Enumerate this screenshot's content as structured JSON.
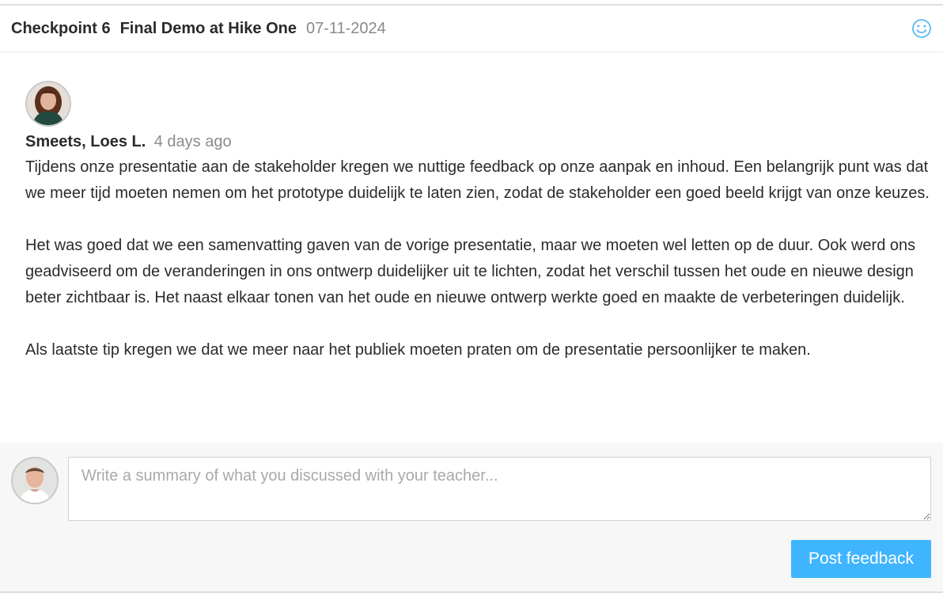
{
  "header": {
    "title": "Checkpoint 6",
    "subtitle": "Final Demo at Hike One",
    "date": "07-11-2024",
    "icon": "smiley-icon",
    "icon_color": "#58b8f0"
  },
  "comment": {
    "author": "Smeets, Loes L.",
    "time": "4 days ago",
    "paragraphs": [
      "Tijdens onze presentatie aan de stakeholder kregen we nuttige feedback op onze aanpak en inhoud. Een belangrijk punt was dat we meer tijd moeten nemen om het prototype duidelijk te laten zien, zodat de stakeholder een goed beeld krijgt van onze keuzes.",
      "Het was goed dat we een samenvatting gaven van de vorige presentatie, maar we moeten wel letten op de duur. Ook werd ons geadviseerd om de veranderingen in ons ontwerp duidelijker uit te lichten, zodat het verschil tussen het oude en nieuwe design beter zichtbaar is. Het naast elkaar tonen van het oude en nieuwe ontwerp werkte goed en maakte de verbeteringen duidelijk.",
      "Als laatste tip kregen we dat we meer naar het publiek moeten praten om de presentatie persoonlijker te maken."
    ]
  },
  "compose": {
    "placeholder": "Write a summary of what you discussed with your teacher...",
    "value": "",
    "button_label": "Post feedback",
    "button_color": "#3fb5ff"
  }
}
